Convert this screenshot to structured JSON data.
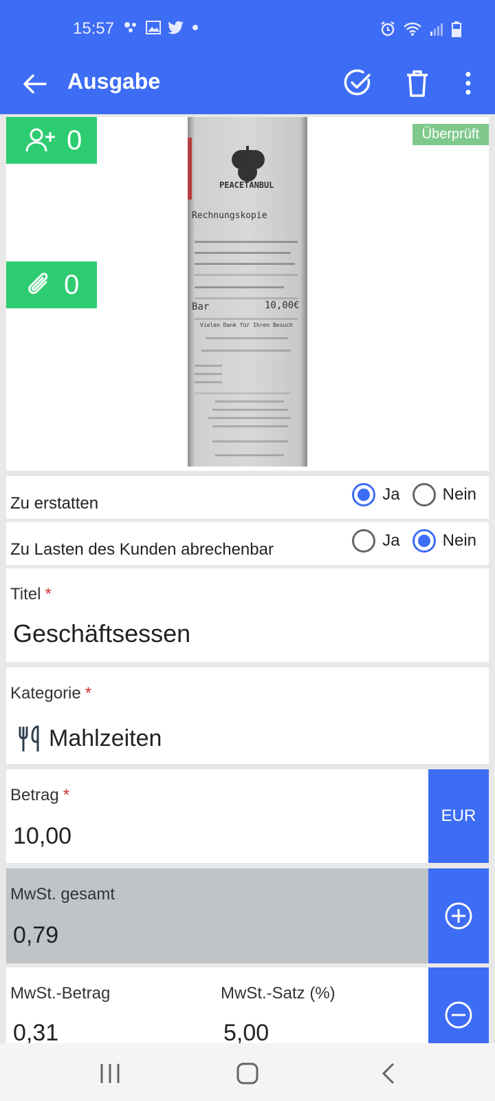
{
  "status_bar": {
    "time": "15:57"
  },
  "app_bar": {
    "title": "Ausgabe"
  },
  "receipt": {
    "participants_count": "0",
    "attachments_count": "0",
    "status_badge": "Überprüft",
    "photo_brand": "PEACETANBUL",
    "photo_heading": "Rechnungskopie",
    "photo_total": "10,00€",
    "photo_bar": "Bar",
    "photo_thanks": "Vielen Dank für Ihren Besuch"
  },
  "refund": {
    "label": "Zu erstatten",
    "yes": "Ja",
    "no": "Nein",
    "selected": "yes"
  },
  "billable": {
    "label": "Zu Lasten des Kunden abrechenbar",
    "yes": "Ja",
    "no": "Nein",
    "selected": "no"
  },
  "title_field": {
    "label": "Titel",
    "required_mark": "*",
    "value": "Geschäftsessen"
  },
  "category_field": {
    "label": "Kategorie",
    "required_mark": "*",
    "value": "Mahlzeiten",
    "icon": "fork-knife-icon"
  },
  "amount_field": {
    "label": "Betrag",
    "required_mark": "*",
    "value": "10,00",
    "currency": "EUR"
  },
  "vat_total_field": {
    "label": "MwSt. gesamt",
    "value": "0,79"
  },
  "vat_line": {
    "amount_label": "MwSt.-Betrag",
    "amount_value": "0,31",
    "rate_label": "MwSt.-Satz (%)",
    "rate_value": "5,00"
  },
  "colors": {
    "primary": "#3d6cf5",
    "green": "#2ecc71",
    "badge": "#7fc98d",
    "required": "#d32f2f",
    "disabled_bg": "#bfc4c8"
  }
}
